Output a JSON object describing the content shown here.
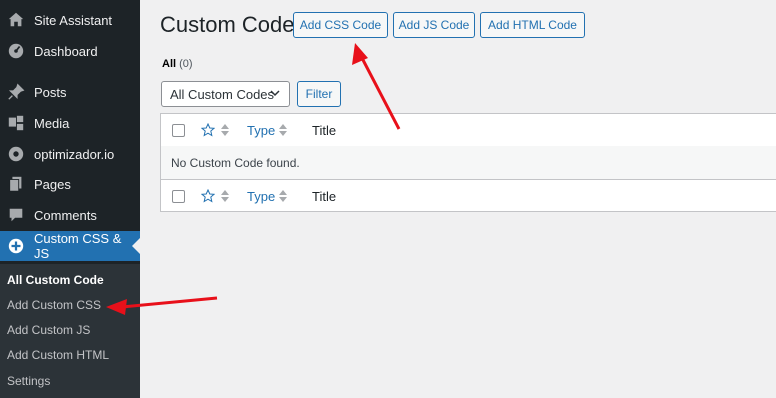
{
  "sidebar": {
    "items": [
      {
        "label": "Site Assistant",
        "icon": "home-icon"
      },
      {
        "label": "Dashboard",
        "icon": "dashboard-icon"
      },
      {
        "label": "Posts",
        "icon": "pushpin-icon"
      },
      {
        "label": "Media",
        "icon": "media-icon"
      },
      {
        "label": "optimizador.io",
        "icon": "gauge-icon"
      },
      {
        "label": "Pages",
        "icon": "pages-icon"
      },
      {
        "label": "Comments",
        "icon": "comments-icon"
      },
      {
        "label": "Custom CSS & JS",
        "icon": "plus-circle-icon",
        "active": true
      }
    ],
    "submenu": [
      {
        "label": "All Custom Code",
        "current": true
      },
      {
        "label": "Add Custom CSS"
      },
      {
        "label": "Add Custom JS"
      },
      {
        "label": "Add Custom HTML"
      },
      {
        "label": "Settings"
      }
    ]
  },
  "main": {
    "title": "Custom Code",
    "buttons": {
      "add_css": "Add CSS Code",
      "add_js": "Add JS Code",
      "add_html": "Add HTML Code"
    },
    "views": {
      "all_label": "All",
      "all_count": "(0)"
    },
    "filter": {
      "select_value": "All Custom Codes",
      "filter_button": "Filter"
    },
    "table": {
      "columns": {
        "type": "Type",
        "title": "Title"
      },
      "empty_message": "No Custom Code found."
    }
  },
  "colors": {
    "sidebar_bg": "#1d2327",
    "accent": "#2271b1",
    "annotation_arrow": "#e8101a"
  }
}
